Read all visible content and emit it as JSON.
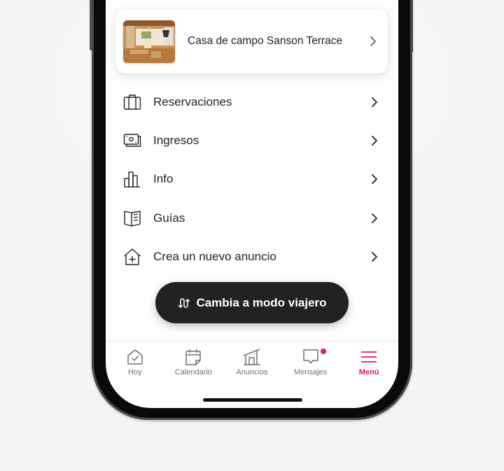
{
  "listing": {
    "title": "Casa de campo Sanson Terrace",
    "thumbnail_alt": "interior-photo"
  },
  "menu": {
    "items": [
      {
        "label": "Reservaciones",
        "icon": "suitcase-icon"
      },
      {
        "label": "Ingresos",
        "icon": "money-icon"
      },
      {
        "label": "Info",
        "icon": "bar-chart-icon"
      },
      {
        "label": "Guías",
        "icon": "guidebook-icon"
      },
      {
        "label": "Crea un nuevo anuncio",
        "icon": "add-home-icon"
      }
    ]
  },
  "switch_mode": {
    "label": "Cambia a modo viajero",
    "icon": "switch-icon"
  },
  "tab_bar": {
    "tabs": [
      {
        "label": "Hoy",
        "icon": "today-icon",
        "active": false
      },
      {
        "label": "Calendario",
        "icon": "calendar-icon",
        "active": false
      },
      {
        "label": "Anuncios",
        "icon": "listings-icon",
        "active": false
      },
      {
        "label": "Mensajes",
        "icon": "messages-icon",
        "active": false,
        "badge": true
      },
      {
        "label": "Menú",
        "icon": "menu-icon",
        "active": true
      }
    ]
  },
  "colors": {
    "accent": "#e31c5f",
    "text": "#222222",
    "muted": "#717171",
    "button_bg": "#222222"
  }
}
